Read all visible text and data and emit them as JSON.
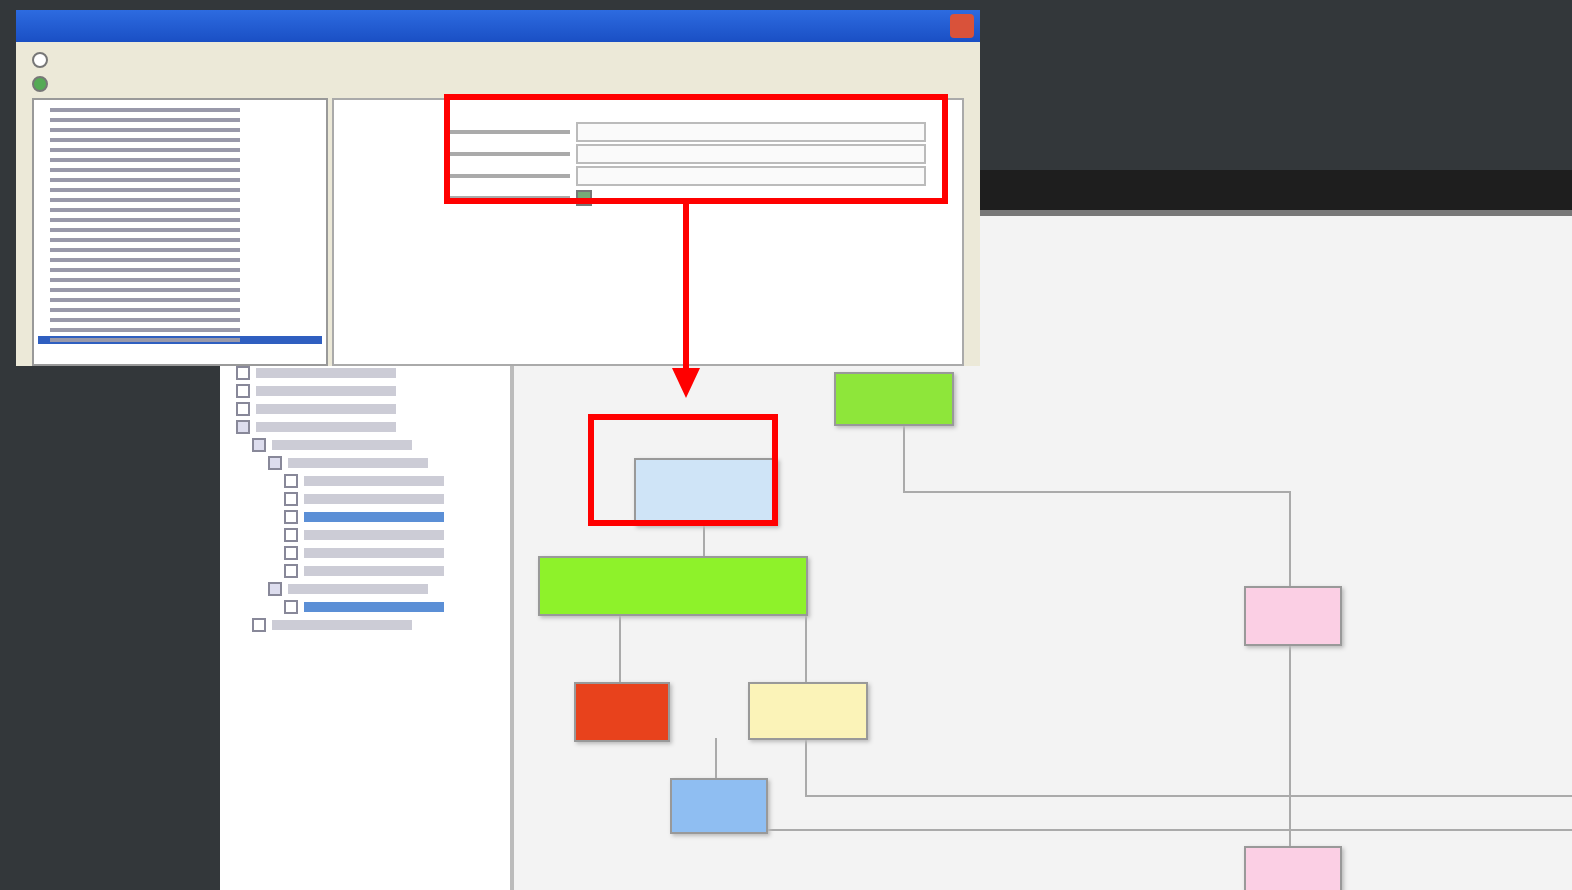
{
  "dialog": {
    "options": [
      {
        "selected": false
      },
      {
        "selected": true
      }
    ],
    "list": [
      {
        "selected": false
      },
      {
        "selected": false
      },
      {
        "selected": false
      },
      {
        "selected": false
      },
      {
        "selected": false
      },
      {
        "selected": false
      },
      {
        "selected": false
      },
      {
        "selected": false
      },
      {
        "selected": false
      },
      {
        "selected": false
      },
      {
        "selected": false
      },
      {
        "selected": false
      },
      {
        "selected": false
      },
      {
        "selected": false
      },
      {
        "selected": false
      },
      {
        "selected": false
      },
      {
        "selected": false
      },
      {
        "selected": false
      },
      {
        "selected": false
      },
      {
        "selected": false
      },
      {
        "selected": false
      },
      {
        "selected": false
      },
      {
        "selected": false
      },
      {
        "selected": true
      }
    ],
    "form": {
      "checked": true
    }
  },
  "tree": [
    {
      "expanded": false,
      "selected": false
    },
    {
      "expanded": false,
      "selected": false
    },
    {
      "expanded": false,
      "selected": false
    },
    {
      "expanded": true,
      "selected": false
    },
    {
      "expanded": true,
      "selected": false
    },
    {
      "expanded": true,
      "selected": false
    },
    {
      "expanded": false,
      "selected": false
    },
    {
      "expanded": false,
      "selected": false
    },
    {
      "expanded": false,
      "selected": true
    },
    {
      "expanded": false,
      "selected": false
    },
    {
      "expanded": false,
      "selected": false
    },
    {
      "expanded": false,
      "selected": false
    },
    {
      "expanded": true,
      "selected": false
    },
    {
      "expanded": false,
      "selected": true
    },
    {
      "expanded": false,
      "selected": false
    }
  ],
  "nodes": [
    {
      "color": "#8ee63a"
    },
    {
      "color": "#cfe4f7"
    },
    {
      "color": "#8ef22a"
    },
    {
      "color": "#e8421c"
    },
    {
      "color": "#fbf3b8"
    },
    {
      "color": "#8fbef2"
    },
    {
      "color": "#fbcfe4"
    },
    {
      "color": "#fbcfe4"
    }
  ]
}
